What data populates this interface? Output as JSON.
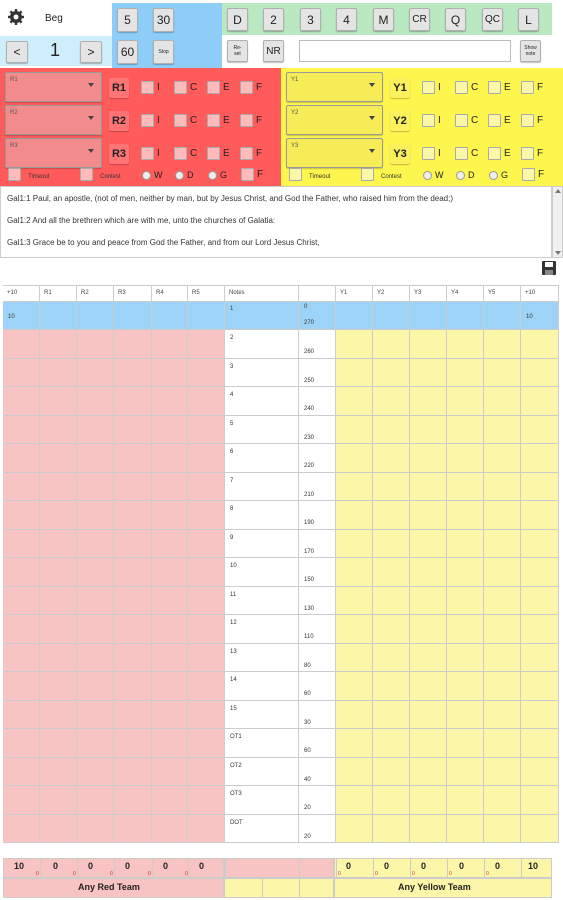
{
  "header": {
    "settings_icon": "gear-icon",
    "beg_label": "Beg",
    "counter_value": "1",
    "prev_label": "<",
    "next_label": ">",
    "btn_5": "5",
    "btn_30": "30",
    "btn_60": "60",
    "btn_stop": "Stop",
    "btn_d": "D",
    "btn_2": "2",
    "btn_3": "3",
    "btn_4": "4",
    "btn_m": "M",
    "btn_cr": "CR",
    "btn_q": "Q",
    "btn_qc": "QC",
    "btn_l": "L",
    "btn_reset": "Re-\nset",
    "btn_nr": "NR",
    "btn_show": "Show\nnote",
    "note_input_value": ""
  },
  "red_panel": {
    "selects": [
      "R1",
      "R2",
      "R3"
    ],
    "rows": [
      {
        "label": "R1",
        "checks": [
          "I",
          "C",
          "E",
          "F"
        ]
      },
      {
        "label": "R2",
        "checks": [
          "I",
          "C",
          "E",
          "F"
        ]
      },
      {
        "label": "R3",
        "checks": [
          "I",
          "C",
          "E",
          "F"
        ]
      }
    ],
    "timeout": "Timeout",
    "contest": "Contest",
    "radio": [
      "W",
      "D",
      "G"
    ],
    "last_check": "F"
  },
  "yellow_panel": {
    "selects": [
      "Y1",
      "Y2",
      "Y3"
    ],
    "rows": [
      {
        "label": "Y1",
        "checks": [
          "I",
          "C",
          "E",
          "F"
        ]
      },
      {
        "label": "Y2",
        "checks": [
          "I",
          "C",
          "E",
          "F"
        ]
      },
      {
        "label": "Y3",
        "checks": [
          "I",
          "C",
          "E",
          "F"
        ]
      }
    ],
    "timeout": "Timeout",
    "contest": "Contest",
    "radio": [
      "W",
      "D",
      "G"
    ],
    "last_check": "F"
  },
  "verses": [
    "Gal1:1 Paul, an apostle, (not of men, neither by man, but by Jesus Christ, and God the Father, who raised him from the dead;)",
    "Gal1:2 And all the brethren which are with me, unto the churches of Galatia:",
    "Gal1:3 Grace be to you and peace from God the Father, and from our Lord Jesus Christ,"
  ],
  "save_icon": "floppy-disk-icon",
  "table": {
    "headers_left": [
      "+10",
      "R1",
      "R2",
      "R3",
      "R4",
      "R5"
    ],
    "notes_header": "Notes",
    "headers_right": [
      "Y1",
      "Y2",
      "Y3",
      "Y4",
      "Y5",
      "+10"
    ],
    "row0": {
      "left": "10",
      "note": "1",
      "top": "0",
      "bottom": "270",
      "right": "10"
    },
    "rows": [
      {
        "note": "2",
        "points": "260"
      },
      {
        "note": "3",
        "points": "250"
      },
      {
        "note": "4",
        "points": "240"
      },
      {
        "note": "5",
        "points": "230"
      },
      {
        "note": "6",
        "points": "220"
      },
      {
        "note": "7",
        "points": "210"
      },
      {
        "note": "8",
        "points": "190"
      },
      {
        "note": "9",
        "points": "170"
      },
      {
        "note": "10",
        "points": "150"
      },
      {
        "note": "11",
        "points": "130"
      },
      {
        "note": "12",
        "points": "110"
      },
      {
        "note": "13",
        "points": "80"
      },
      {
        "note": "14",
        "points": "60"
      },
      {
        "note": "15",
        "points": "30"
      },
      {
        "note": "OT1",
        "points": "60"
      },
      {
        "note": "OT2",
        "points": "40"
      },
      {
        "note": "OT3",
        "points": "20"
      },
      {
        "note": "DOT",
        "points": "20"
      }
    ]
  },
  "totals": {
    "red_scores": [
      "10",
      "0",
      "0",
      "0",
      "0",
      "0"
    ],
    "red_sub": [
      "0",
      "0",
      "0",
      "0",
      "0"
    ],
    "yellow_scores": [
      "0",
      "0",
      "0",
      "0",
      "0",
      "10"
    ],
    "yellow_sub": [
      "0",
      "0",
      "0",
      "0",
      "0"
    ],
    "red_team_label": "Any Red Team",
    "yellow_team_label": "Any Yellow Team"
  },
  "colors": {
    "red": "#ff5b5b",
    "red_light": "#f8c3c3",
    "yellow": "#fdf64f",
    "yellow_light": "#fbf6a8",
    "blue": "#8fcdf9",
    "green": "#b9e8c1",
    "highlight_row": "#9dd3f7"
  }
}
